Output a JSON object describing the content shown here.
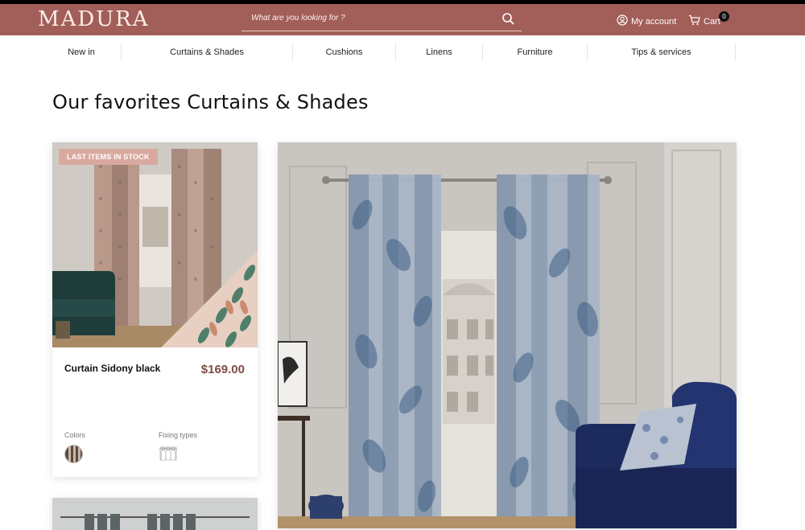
{
  "header": {
    "logo": "MADURA",
    "search_placeholder": "What are you looking for ?",
    "account_label": "My account",
    "cart_label": "Cart",
    "cart_count": "0"
  },
  "nav": {
    "items": [
      {
        "label": "New in"
      },
      {
        "label": "Curtains & Shades"
      },
      {
        "label": "Cushions"
      },
      {
        "label": "Linens"
      },
      {
        "label": "Furniture"
      },
      {
        "label": "Tips & services"
      }
    ]
  },
  "main": {
    "title": "Our favorites Curtains & Shades"
  },
  "product": {
    "badge": "LAST ITEMS IN STOCK",
    "name": "Curtain Sidony black",
    "price": "$169.00",
    "colors_label": "Colors",
    "fixing_label": "Fixing types"
  },
  "colors": {
    "header_bg": "#a25e58",
    "badge_bg": "#d9a9a0",
    "price": "#7e4b47"
  }
}
